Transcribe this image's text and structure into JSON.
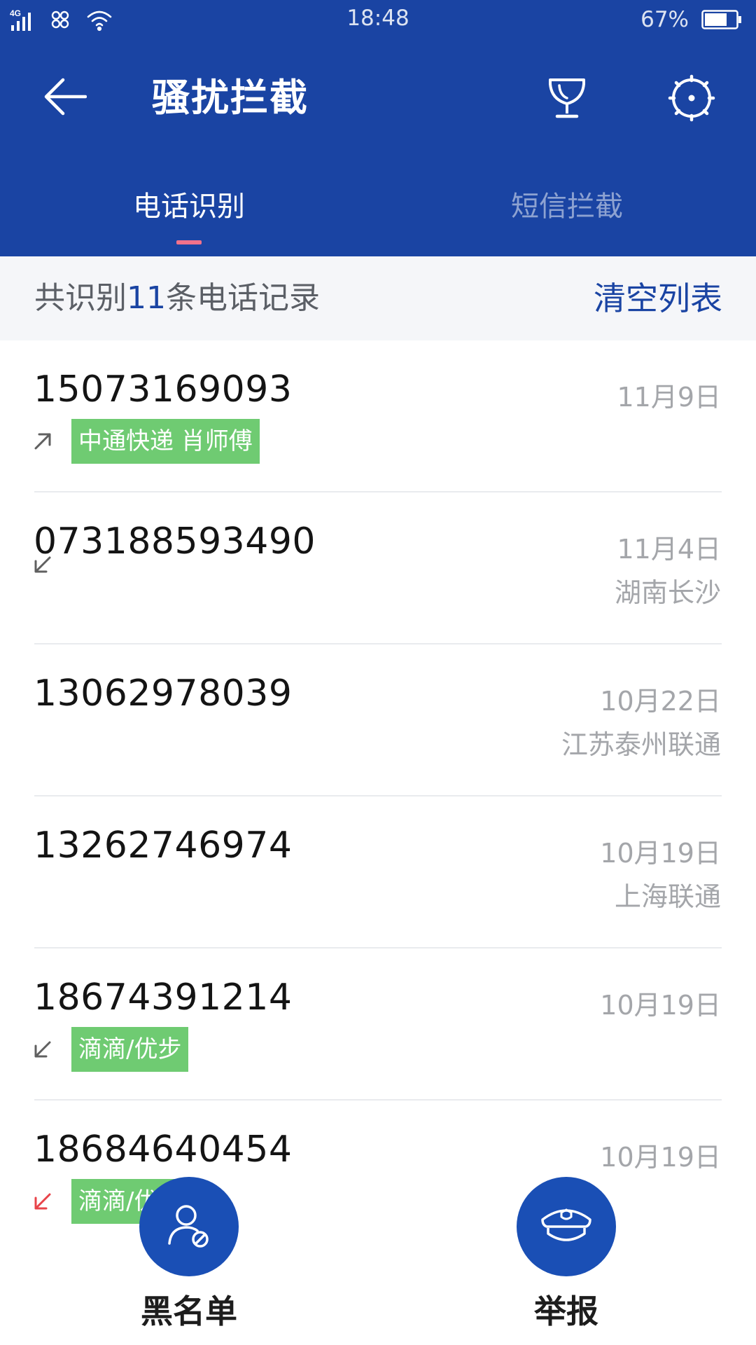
{
  "status_bar": {
    "network": "4G",
    "time": "18:48",
    "battery": "67%"
  },
  "header": {
    "title": "骚扰拦截"
  },
  "tabs": [
    {
      "label": "电话识别",
      "active": true
    },
    {
      "label": "短信拦截",
      "active": false
    }
  ],
  "summary": {
    "prefix": "共识别",
    "count": "11",
    "suffix": "条电话记录",
    "clear_label": "清空列表"
  },
  "calls": [
    {
      "number": "15073169093",
      "date": "11月9日",
      "location": "",
      "direction": "outgoing",
      "tag": "中通快递 肖师傅"
    },
    {
      "number": "073188593490",
      "date": "11月4日",
      "location": "湖南长沙",
      "direction": "incoming",
      "tag": ""
    },
    {
      "number": "13062978039",
      "date": "10月22日",
      "location": "江苏泰州联通",
      "direction": "",
      "tag": ""
    },
    {
      "number": "13262746974",
      "date": "10月19日",
      "location": "上海联通",
      "direction": "",
      "tag": ""
    },
    {
      "number": "18674391214",
      "date": "10月19日",
      "location": "",
      "direction": "incoming",
      "tag": "滴滴/优步"
    },
    {
      "number": "18684640454",
      "date": "10月19日",
      "location": "",
      "direction": "missed",
      "tag": "滴滴/优步"
    }
  ],
  "actions": {
    "blacklist_label": "黑名单",
    "report_label": "举报"
  },
  "colors": {
    "header_bg": "#1a44a3",
    "accent": "#1a44a3",
    "tab_indicator": "#f2728b",
    "tag_bg": "#6fcb72",
    "missed_call": "#e8444a",
    "fab_bg": "#1a4fb5"
  },
  "icons": {
    "back": "arrow-left-icon",
    "trophy": "trophy-icon",
    "settings": "gear-icon",
    "blacklist": "user-block-icon",
    "report": "police-cap-icon"
  }
}
